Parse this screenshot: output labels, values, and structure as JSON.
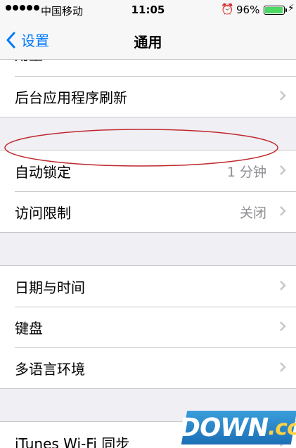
{
  "status_bar": {
    "carrier": "中国移动",
    "time": "11:05",
    "battery_percent": "96%",
    "battery_level": 0.96,
    "icons": [
      "signal-dots",
      "alarm-icon",
      "battery-icon",
      "charging-icon"
    ]
  },
  "nav": {
    "back_label": "设置",
    "title": "通用",
    "accent_color": "#007aff"
  },
  "settings": {
    "partial_top_row": "用量",
    "background_refresh": "后台应用程序刷新",
    "auto_lock": {
      "label": "自动锁定",
      "value": "1 分钟"
    },
    "restrictions": {
      "label": "访问限制",
      "value": "关闭"
    },
    "date_time": "日期与时间",
    "keyboard": "键盘",
    "language_region": "多语言环境",
    "itunes_sync": "iTunes Wi-Fi 同步"
  },
  "watermark": {
    "main": "DOWN",
    "suffix": ".cc"
  }
}
